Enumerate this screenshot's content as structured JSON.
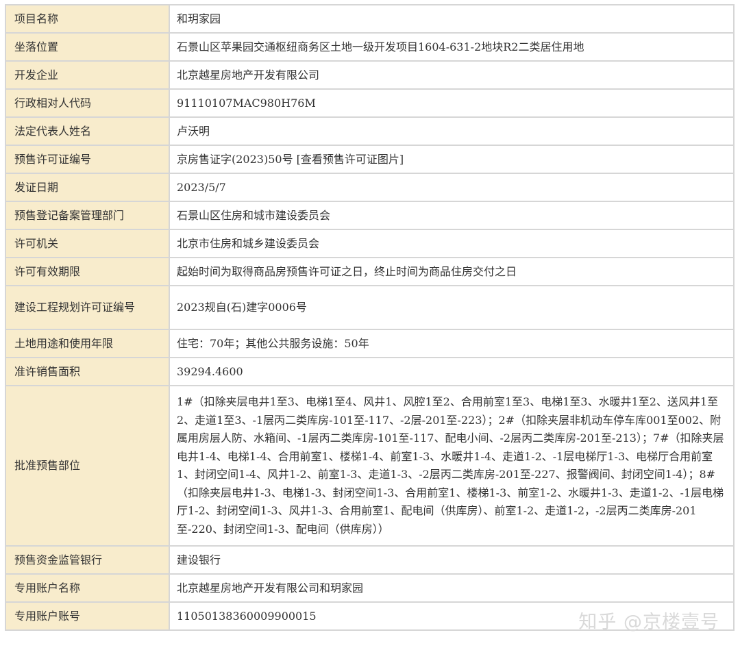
{
  "rows": [
    {
      "label": "项目名称",
      "value": "和玥家园"
    },
    {
      "label": "坐落位置",
      "value": "石景山区苹果园交通枢纽商务区土地一级开发项目1604-631-2地块R2二类居住用地"
    },
    {
      "label": "开发企业",
      "value": "北京越星房地产开发有限公司"
    },
    {
      "label": "行政相对人代码",
      "value": "91110107MAC980H76M"
    },
    {
      "label": "法定代表人姓名",
      "value": "卢沃明"
    },
    {
      "label": "预售许可证编号",
      "value": "京房售证字(2023)50号 [查看预售许可证图片]"
    },
    {
      "label": "发证日期",
      "value": "2023/5/7"
    },
    {
      "label": "预售登记备案管理部门",
      "value": "石景山区住房和城市建设委员会"
    },
    {
      "label": "许可机关",
      "value": "北京市住房和城乡建设委员会"
    },
    {
      "label": "许可有效期限",
      "value": "起始时间为取得商品房预售许可证之日，终止时间为商品住房交付之日"
    },
    {
      "label": "建设工程规划许可证编号",
      "value": "2023规自(石)建字0006号"
    },
    {
      "label": "土地用途和使用年限",
      "value": "住宅：70年；其他公共服务设施：50年"
    },
    {
      "label": "准许销售面积",
      "value": "39294.4600"
    },
    {
      "label": "批准预售部位",
      "value": "1#（扣除夹层电井1至3、电梯1至4、风井1、风腔1至2、合用前室1至3、电梯1至3、水暖井1至2、送风井1至2、走道1至3、-1层丙二类库房-101至-117、-2层-201至-223）；2#（扣除夹层非机动车停车库001至002、附属用房层人防、水箱间、-1层丙二类库房-101至-117、配电小间、-2层丙二类库房-201至-213）；7#（扣除夹层电井1-4、电梯1-4、合用前室1、楼梯1-4、前室1-3、水暖井1-4、走道1-2、-1层电梯厅1-3、电梯厅合用前室1、封闭空间1-4、风井1-2、前室1-3、走道1-3、-2层丙二类库房-201至-227、报警阀间、封闭空间1-4）；8#（扣除夹层电井1-3、电梯1-3、封闭空间1-3、合用前室1、楼梯1-3、前室1-2、水暖井1-3、走道1-2、-1层电梯厅1-2、封闭空间1-3、风井1-3、合用前室1、配电间（供库房）、前室1-2、走道1-2，-2层丙二类库房-201至-220、封闭空间1-3、配电间（供库房））"
    },
    {
      "label": "预售资金监管银行",
      "value": "建设银行"
    },
    {
      "label": "专用账户名称",
      "value": "北京越星房地产开发有限公司和玥家园"
    },
    {
      "label": "专用账户账号",
      "value": "11050138360009900015"
    }
  ],
  "watermark": "知乎 @京楼壹号"
}
